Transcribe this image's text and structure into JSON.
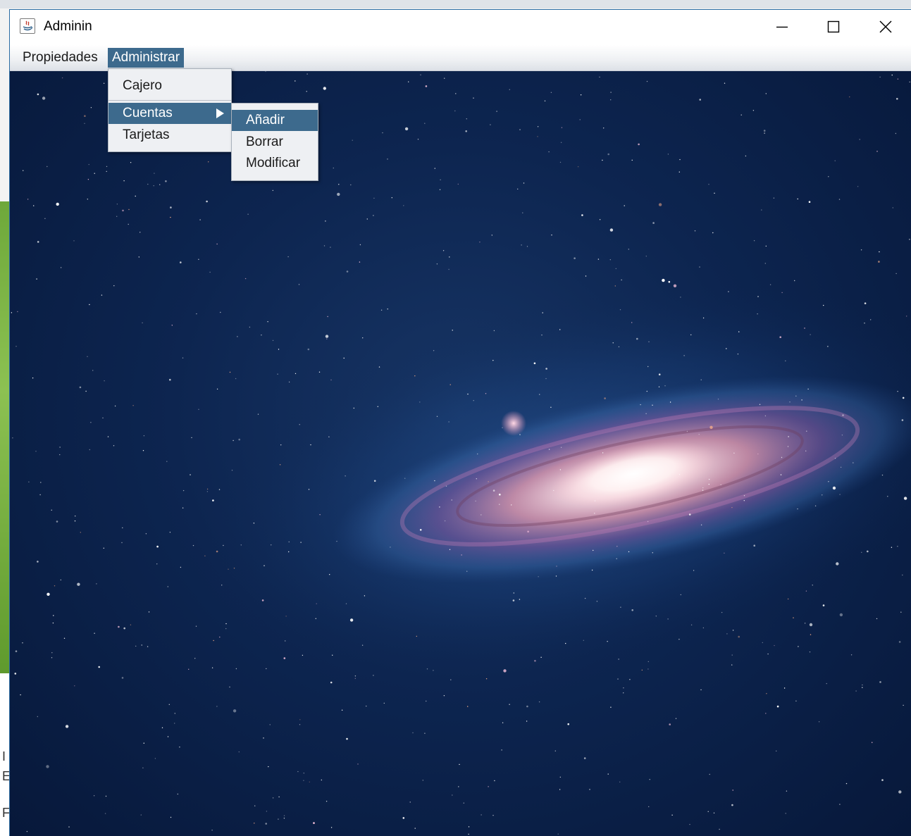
{
  "window": {
    "title": "Adminin",
    "app_icon": "java-icon",
    "controls": {
      "minimize": "minimize-icon",
      "maximize": "maximize-icon",
      "close": "close-icon"
    }
  },
  "menubar": {
    "items": [
      {
        "label": "Propiedades",
        "active": false
      },
      {
        "label": "Administrar",
        "active": true
      }
    ]
  },
  "administrar_menu": {
    "items": [
      {
        "label": "Cajero",
        "highlighted": false
      },
      {
        "label": "Cuentas",
        "highlighted": true,
        "has_submenu": true
      },
      {
        "label": "Tarjetas",
        "highlighted": false
      }
    ]
  },
  "cuentas_submenu": {
    "items": [
      {
        "label": "Añadir",
        "highlighted": true
      },
      {
        "label": "Borrar",
        "highlighted": false
      },
      {
        "label": "Modificar",
        "highlighted": false
      }
    ]
  },
  "desktop_fragments": [
    "I",
    "E",
    "F"
  ],
  "colors": {
    "menu_highlight": "#3d6a8d",
    "menu_background": "#eef0f3",
    "space_background": "#0d2550"
  }
}
